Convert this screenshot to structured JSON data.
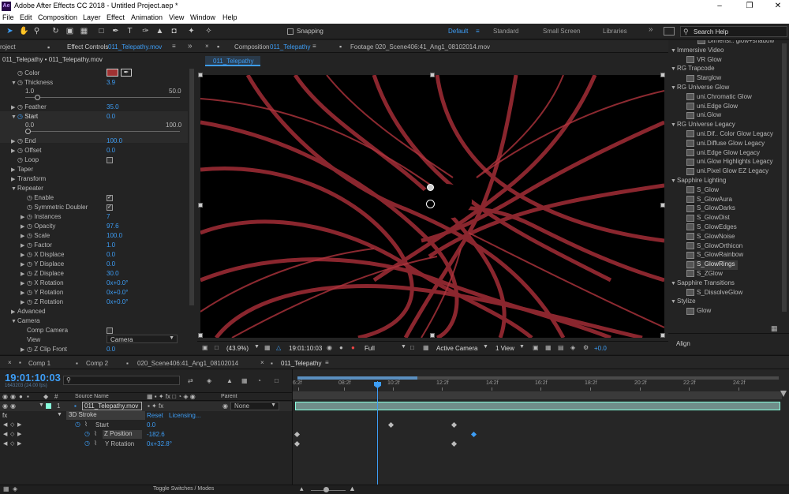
{
  "app": {
    "title": "Adobe After Effects CC 2018 - Untitled Project.aep *",
    "logo": "Ae"
  },
  "menu": [
    "File",
    "Edit",
    "Composition",
    "Layer",
    "Effect",
    "Animation",
    "View",
    "Window",
    "Help"
  ],
  "toolbar": {
    "snapping": "Snapping",
    "workspaces": [
      "Default",
      "Standard",
      "Small Screen",
      "Libraries"
    ],
    "search_placeholder": "Search Help"
  },
  "effect_controls": {
    "tab_left": "roject",
    "tab": "Effect Controls",
    "tab_layer": "011_Telepathy.mov",
    "breadcrumb": "011_Telepathy • 011_Telepathy.mov",
    "rows": [
      {
        "label": "Color",
        "value": ""
      },
      {
        "label": "Thickness",
        "value": "3.9"
      },
      {
        "label": "1.0",
        "value": "50.0"
      },
      {
        "label": "Feather",
        "value": "35.0"
      },
      {
        "label": "Start",
        "value": "0.0"
      },
      {
        "label": "0.0",
        "value": "100.0"
      },
      {
        "label": "End",
        "value": "100.0"
      },
      {
        "label": "Offset",
        "value": "0.0"
      },
      {
        "label": "Loop",
        "value": ""
      },
      {
        "label": "Taper",
        "value": ""
      },
      {
        "label": "Transform",
        "value": ""
      },
      {
        "label": "Repeater",
        "value": ""
      },
      {
        "label": "Enable",
        "value": ""
      },
      {
        "label": "Symmetric Doubler",
        "value": ""
      },
      {
        "label": "Instances",
        "value": "7"
      },
      {
        "label": "Opacity",
        "value": "97.6"
      },
      {
        "label": "Scale",
        "value": "100.0"
      },
      {
        "label": "Factor",
        "value": "1.0"
      },
      {
        "label": "X Displace",
        "value": "0.0"
      },
      {
        "label": "Y Displace",
        "value": "0.0"
      },
      {
        "label": "Z Displace",
        "value": "30.0"
      },
      {
        "label": "X Rotation",
        "value": "0x+0.0°"
      },
      {
        "label": "Y Rotation",
        "value": "0x+0.0°"
      },
      {
        "label": "Z Rotation",
        "value": "0x+0.0°"
      },
      {
        "label": "Advanced",
        "value": ""
      },
      {
        "label": "Camera",
        "value": ""
      },
      {
        "label": "Comp Camera",
        "value": ""
      },
      {
        "label": "View",
        "value": "Camera"
      },
      {
        "label": "Z Clip Front",
        "value": "0.0"
      }
    ]
  },
  "composition": {
    "tab_prefix": "Composition",
    "tab_name": "011_Telepathy",
    "footage_tab": "Footage 020_Scene406:41_Ang1_08102014.mov",
    "subtab": "011_Telepathy",
    "zoom": "(43.9%)",
    "time": "19:01:10:03",
    "resolution": "Full",
    "camera": "Active Camera",
    "views": "1 View",
    "exposure": "+0.0"
  },
  "effects_list": {
    "top_item": "Dimensi.. glow+shadow",
    "groups": [
      {
        "name": "Immersive Video",
        "items": [
          "VR Glow"
        ]
      },
      {
        "name": "RG Trapcode",
        "items": [
          "Starglow"
        ]
      },
      {
        "name": "RG Universe Glow",
        "items": [
          "uni.Chromatic Glow",
          "uni.Edge Glow",
          "uni.Glow"
        ]
      },
      {
        "name": "RG Universe Legacy",
        "items": [
          "uni.Dif.. Color Glow Legacy",
          "uni.Diffuse Glow Legacy",
          "uni.Edge Glow Legacy",
          "uni.Glow Highlights Legacy",
          "uni.Pixel Glow EZ Legacy"
        ]
      },
      {
        "name": "Sapphire Lighting",
        "items": [
          "S_Glow",
          "S_GlowAura",
          "S_GlowDarks",
          "S_GlowDist",
          "S_GlowEdges",
          "S_GlowNoise",
          "S_GlowOrthicon",
          "S_GlowRainbow",
          "S_GlowRings",
          "S_ZGlow"
        ]
      },
      {
        "name": "Sapphire Transitions",
        "items": [
          "S_DissolveGlow"
        ]
      },
      {
        "name": "Stylize",
        "items": [
          "Glow"
        ]
      }
    ],
    "align": "Align"
  },
  "timeline": {
    "tabs": [
      "Comp 1",
      "Comp 2",
      "020_Scene406:41_Ang1_08102014",
      "011_Telepathy"
    ],
    "timecode": "19:01:10:03",
    "frames": "1643203 (24.00 fps)",
    "col_source": "Source Name",
    "col_parent": "Parent",
    "layer_num": "1",
    "layer_name": "011_Telepathy.mov",
    "parent_val": "None",
    "effect": "3D Stroke",
    "reset": "Reset",
    "licensing": "Licensing...",
    "props": [
      {
        "name": "Start",
        "value": "0.0"
      },
      {
        "name": "Z Position",
        "value": "-182.6"
      },
      {
        "name": "Y Rotation",
        "value": "0x+32.8°"
      }
    ],
    "ruler": [
      "6:2f",
      "08:2f",
      "10:2f",
      "12:2f",
      "14:2f",
      "16:2f",
      "18:2f",
      "20:2f",
      "22:2f",
      "24:2f"
    ],
    "toggle": "Toggle Switches / Modes"
  }
}
